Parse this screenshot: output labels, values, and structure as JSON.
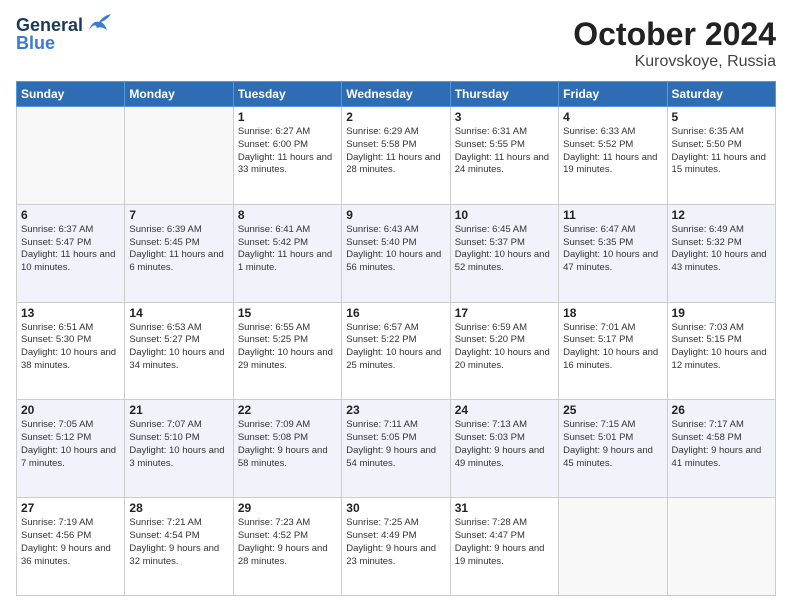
{
  "logo": {
    "general": "General",
    "blue": "Blue"
  },
  "title": "October 2024",
  "subtitle": "Kurovskoye, Russia",
  "weekdays": [
    "Sunday",
    "Monday",
    "Tuesday",
    "Wednesday",
    "Thursday",
    "Friday",
    "Saturday"
  ],
  "weeks": [
    [
      {
        "day": "",
        "info": ""
      },
      {
        "day": "",
        "info": ""
      },
      {
        "day": "1",
        "info": "Sunrise: 6:27 AM\nSunset: 6:00 PM\nDaylight: 11 hours\nand 33 minutes."
      },
      {
        "day": "2",
        "info": "Sunrise: 6:29 AM\nSunset: 5:58 PM\nDaylight: 11 hours\nand 28 minutes."
      },
      {
        "day": "3",
        "info": "Sunrise: 6:31 AM\nSunset: 5:55 PM\nDaylight: 11 hours\nand 24 minutes."
      },
      {
        "day": "4",
        "info": "Sunrise: 6:33 AM\nSunset: 5:52 PM\nDaylight: 11 hours\nand 19 minutes."
      },
      {
        "day": "5",
        "info": "Sunrise: 6:35 AM\nSunset: 5:50 PM\nDaylight: 11 hours\nand 15 minutes."
      }
    ],
    [
      {
        "day": "6",
        "info": "Sunrise: 6:37 AM\nSunset: 5:47 PM\nDaylight: 11 hours\nand 10 minutes."
      },
      {
        "day": "7",
        "info": "Sunrise: 6:39 AM\nSunset: 5:45 PM\nDaylight: 11 hours\nand 6 minutes."
      },
      {
        "day": "8",
        "info": "Sunrise: 6:41 AM\nSunset: 5:42 PM\nDaylight: 11 hours\nand 1 minute."
      },
      {
        "day": "9",
        "info": "Sunrise: 6:43 AM\nSunset: 5:40 PM\nDaylight: 10 hours\nand 56 minutes."
      },
      {
        "day": "10",
        "info": "Sunrise: 6:45 AM\nSunset: 5:37 PM\nDaylight: 10 hours\nand 52 minutes."
      },
      {
        "day": "11",
        "info": "Sunrise: 6:47 AM\nSunset: 5:35 PM\nDaylight: 10 hours\nand 47 minutes."
      },
      {
        "day": "12",
        "info": "Sunrise: 6:49 AM\nSunset: 5:32 PM\nDaylight: 10 hours\nand 43 minutes."
      }
    ],
    [
      {
        "day": "13",
        "info": "Sunrise: 6:51 AM\nSunset: 5:30 PM\nDaylight: 10 hours\nand 38 minutes."
      },
      {
        "day": "14",
        "info": "Sunrise: 6:53 AM\nSunset: 5:27 PM\nDaylight: 10 hours\nand 34 minutes."
      },
      {
        "day": "15",
        "info": "Sunrise: 6:55 AM\nSunset: 5:25 PM\nDaylight: 10 hours\nand 29 minutes."
      },
      {
        "day": "16",
        "info": "Sunrise: 6:57 AM\nSunset: 5:22 PM\nDaylight: 10 hours\nand 25 minutes."
      },
      {
        "day": "17",
        "info": "Sunrise: 6:59 AM\nSunset: 5:20 PM\nDaylight: 10 hours\nand 20 minutes."
      },
      {
        "day": "18",
        "info": "Sunrise: 7:01 AM\nSunset: 5:17 PM\nDaylight: 10 hours\nand 16 minutes."
      },
      {
        "day": "19",
        "info": "Sunrise: 7:03 AM\nSunset: 5:15 PM\nDaylight: 10 hours\nand 12 minutes."
      }
    ],
    [
      {
        "day": "20",
        "info": "Sunrise: 7:05 AM\nSunset: 5:12 PM\nDaylight: 10 hours\nand 7 minutes."
      },
      {
        "day": "21",
        "info": "Sunrise: 7:07 AM\nSunset: 5:10 PM\nDaylight: 10 hours\nand 3 minutes."
      },
      {
        "day": "22",
        "info": "Sunrise: 7:09 AM\nSunset: 5:08 PM\nDaylight: 9 hours\nand 58 minutes."
      },
      {
        "day": "23",
        "info": "Sunrise: 7:11 AM\nSunset: 5:05 PM\nDaylight: 9 hours\nand 54 minutes."
      },
      {
        "day": "24",
        "info": "Sunrise: 7:13 AM\nSunset: 5:03 PM\nDaylight: 9 hours\nand 49 minutes."
      },
      {
        "day": "25",
        "info": "Sunrise: 7:15 AM\nSunset: 5:01 PM\nDaylight: 9 hours\nand 45 minutes."
      },
      {
        "day": "26",
        "info": "Sunrise: 7:17 AM\nSunset: 4:58 PM\nDaylight: 9 hours\nand 41 minutes."
      }
    ],
    [
      {
        "day": "27",
        "info": "Sunrise: 7:19 AM\nSunset: 4:56 PM\nDaylight: 9 hours\nand 36 minutes."
      },
      {
        "day": "28",
        "info": "Sunrise: 7:21 AM\nSunset: 4:54 PM\nDaylight: 9 hours\nand 32 minutes."
      },
      {
        "day": "29",
        "info": "Sunrise: 7:23 AM\nSunset: 4:52 PM\nDaylight: 9 hours\nand 28 minutes."
      },
      {
        "day": "30",
        "info": "Sunrise: 7:25 AM\nSunset: 4:49 PM\nDaylight: 9 hours\nand 23 minutes."
      },
      {
        "day": "31",
        "info": "Sunrise: 7:28 AM\nSunset: 4:47 PM\nDaylight: 9 hours\nand 19 minutes."
      },
      {
        "day": "",
        "info": ""
      },
      {
        "day": "",
        "info": ""
      }
    ]
  ]
}
